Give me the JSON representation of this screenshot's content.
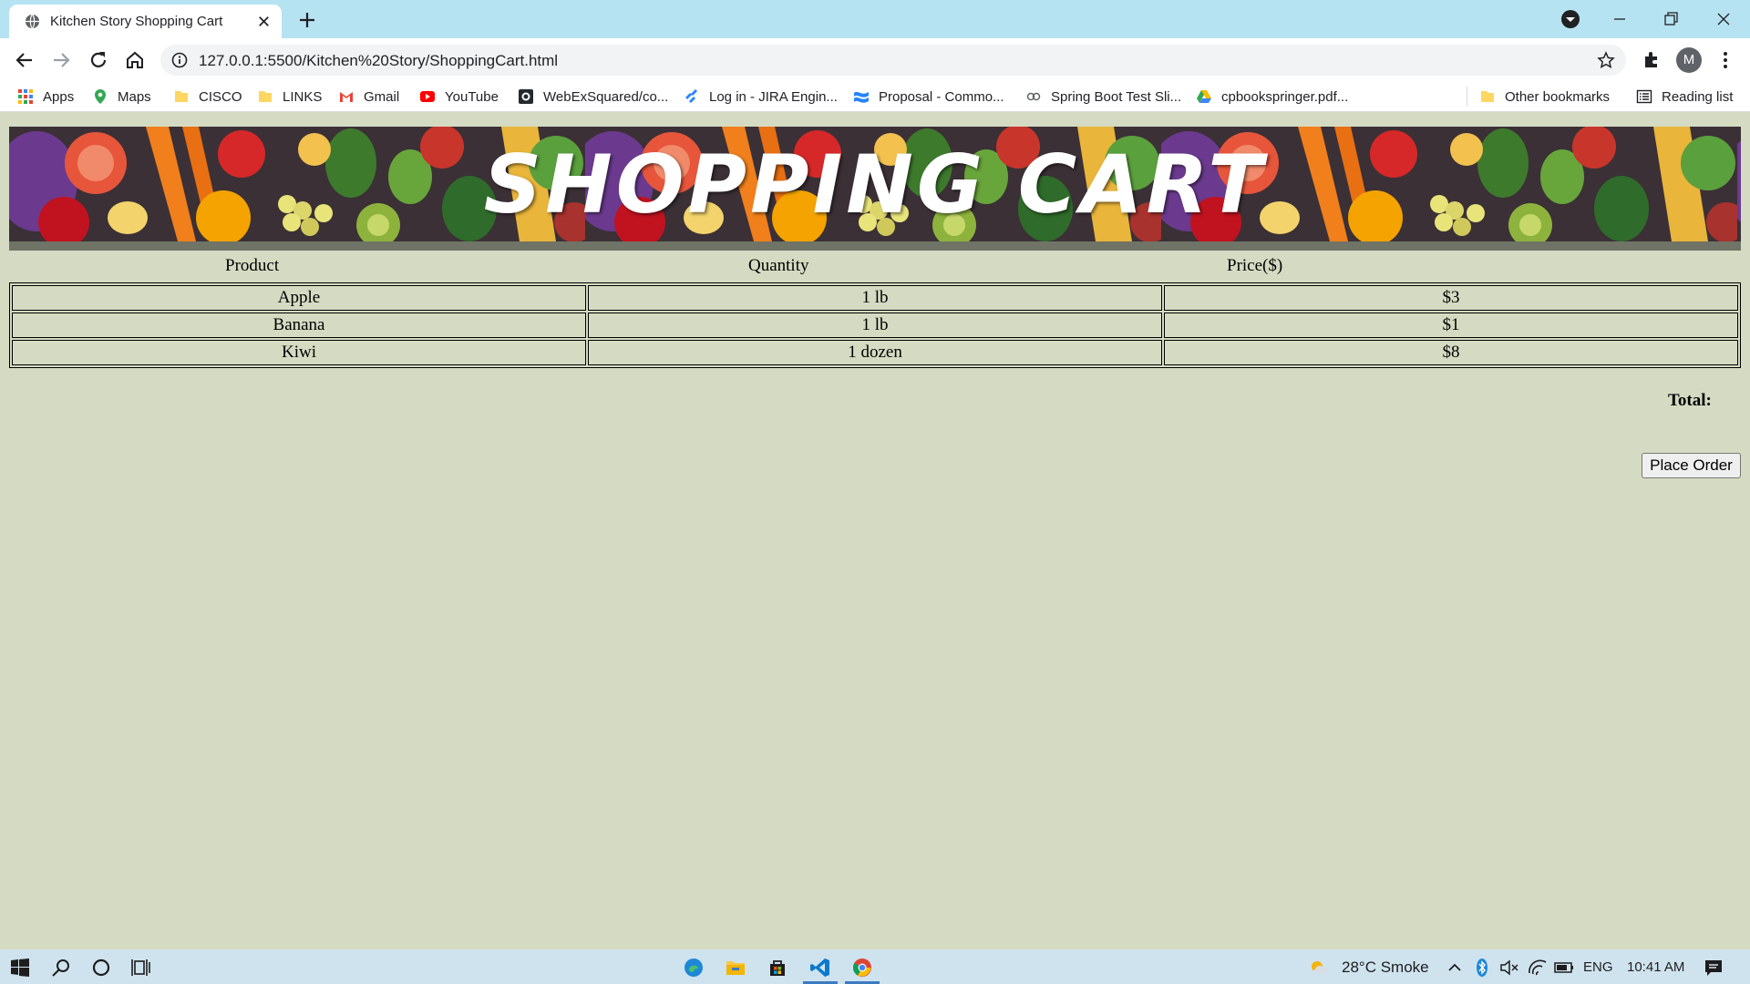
{
  "browser": {
    "tab_title": "Kitchen Story Shopping Cart",
    "url": "127.0.0.1:5500/Kitchen%20Story/ShoppingCart.html",
    "profile_initial": "M",
    "bookmarks": [
      "Apps",
      "Maps",
      "CISCO",
      "LINKS",
      "Gmail",
      "YouTube",
      "WebExSquared/co...",
      "Log in - JIRA Engin...",
      "Proposal - Commo...",
      "Spring Boot Test Sli...",
      "cpbookspringer.pdf..."
    ],
    "other_bookmarks": "Other bookmarks",
    "reading_list": "Reading list"
  },
  "page": {
    "banner_title": "SHOPPING CART",
    "columns": [
      "Product",
      "Quantity",
      "Price($)"
    ],
    "items": [
      {
        "product": "Apple",
        "quantity": "1 lb",
        "price": "$3"
      },
      {
        "product": "Banana",
        "quantity": "1 lb",
        "price": "$1"
      },
      {
        "product": "Kiwi",
        "quantity": "1 dozen",
        "price": "$8"
      }
    ],
    "total_label": "Total:",
    "order_button": "Place Order"
  },
  "taskbar": {
    "weather": "28°C  Smoke",
    "language": "ENG",
    "time": "10:41 AM"
  },
  "colors": {
    "page_background": "#d4dbc2",
    "titlebar": "#b6e3f1",
    "taskbar": "#cfe3ef"
  }
}
